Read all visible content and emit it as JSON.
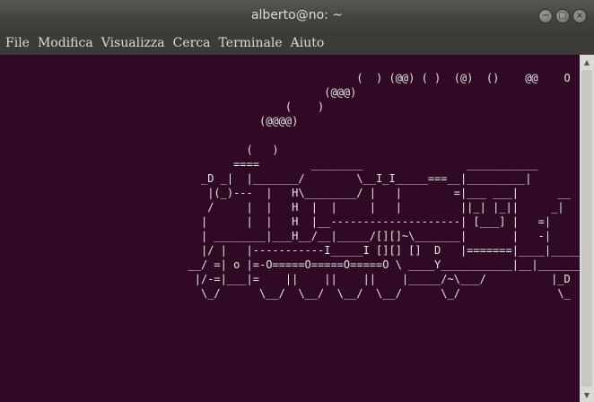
{
  "window": {
    "title": "alberto@no: ~"
  },
  "controls": {
    "minimize": "−",
    "maximize": "□",
    "close": "×"
  },
  "menu": [
    "File",
    "Modifica",
    "Visualizza",
    "Cerca",
    "Terminale",
    "Aiuto"
  ],
  "terminal": {
    "lines": [
      "                                                       (  ) (@@) ( )  (@)  ()    @@    O",
      "                                                  (@@@)",
      "                                            (    )",
      "                                        (@@@@)",
      "",
      "                                      (   )",
      "                                    ====        ________                ___________",
      "                               _D _|  |_______/        \\__I_I_____===__|_________|",
      "                                |(_)---  |   H\\________/ |   |        =|___ ___|      __",
      "                                /     |  |   H  |  |     |   |         ||_| |_||     _|",
      "                               |      |  |   H  |__--------------------| [___] |   =|",
      "                               | ________|___H__/__|_____/[][]~\\_______|       |   -|",
      "                               |/ |   |-----------I_____I [][] []  D   |=======|____|_____",
      "                             __/ =| o |=-O=====O=====O=====O \\ ____Y___________|__|_______",
      "                              |/-=|___|=    ||    ||    ||    |_____/~\\___/          |_D",
      "                               \\_/      \\__/  \\__/  \\__/  \\__/      \\_/               \\_"
    ]
  },
  "colors": {
    "terminal_bg": "#300a24",
    "terminal_fg": "#e6e6e6",
    "titlebar": "#3c3b37"
  }
}
